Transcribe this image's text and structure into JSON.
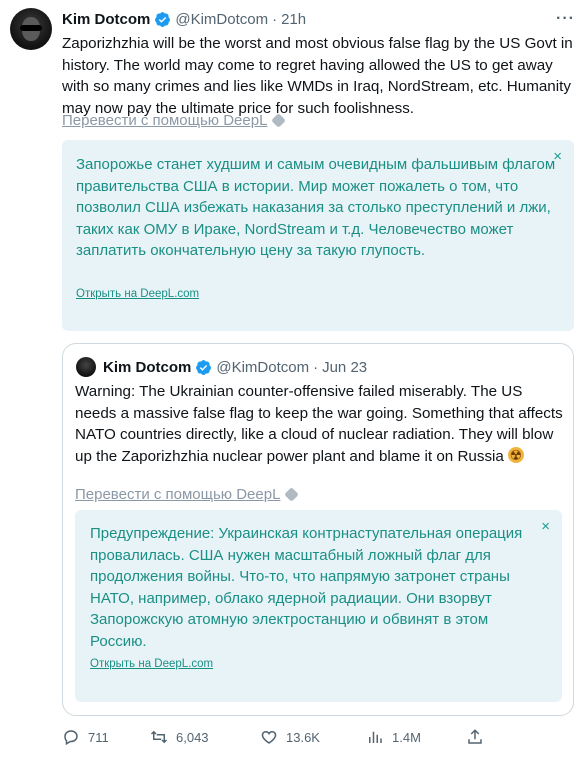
{
  "tweet": {
    "author_name": "Kim Dotcom",
    "handle": "@KimDotcom",
    "separator": "·",
    "time": "21h",
    "text": "Zaporizhzhia will be the worst and most obvious false flag by the US Govt in history. The world may come to regret having allowed the US to get away with so many crimes and lies like WMDs in Iraq, NordStream, etc. Humanity may now pay the ultimate price for such foolishness.",
    "translate_label": "Перевести с помощью DeepL",
    "translation": {
      "text": "Запорожье станет худшим и самым очевидным фальшивым флагом правительства США в истории. Мир может пожалеть о том, что позволил США избежать наказания за столько преступлений и лжи, таких как ОМУ в Ираке, NordStream и т.д. Человечество может заплатить окончательную цену за такую глупость.",
      "open_link": "Открыть на DeepL.com",
      "close_symbol": "×"
    }
  },
  "quote": {
    "author_name": "Kim Dotcom",
    "handle": "@KimDotcom",
    "separator": "·",
    "time": "Jun 23",
    "text": "Warning: The Ukrainian counter-offensive failed miserably. The US needs a massive false flag to keep the war going. Something that affects NATO countries directly, like a cloud of nuclear radiation. They will blow up the Zaporizhzhia nuclear power plant and blame it on Russia",
    "emoji": "radioactive-emoji",
    "translate_label": "Перевести с помощью DeepL",
    "translation": {
      "text": "Предупреждение: Украинская контрнаступательная операция провалилась. США нужен масштабный ложный флаг для продолжения войны. Что-то, что напрямую затронет страны НАТО, например, облако ядерной радиации. Они взорвут Запорожскую атомную электростанцию и обвинят в этом Россию.",
      "open_link": "Открыть на DeepL.com",
      "close_symbol": "×"
    }
  },
  "actions": {
    "replies": "711",
    "retweets": "6,043",
    "likes": "13.6K",
    "views": "1.4M"
  },
  "colors": {
    "accent": "#1d9bf0",
    "translation_bg": "#e8f3f8",
    "translation_text": "#1a8f84",
    "secondary_text": "#536471"
  }
}
